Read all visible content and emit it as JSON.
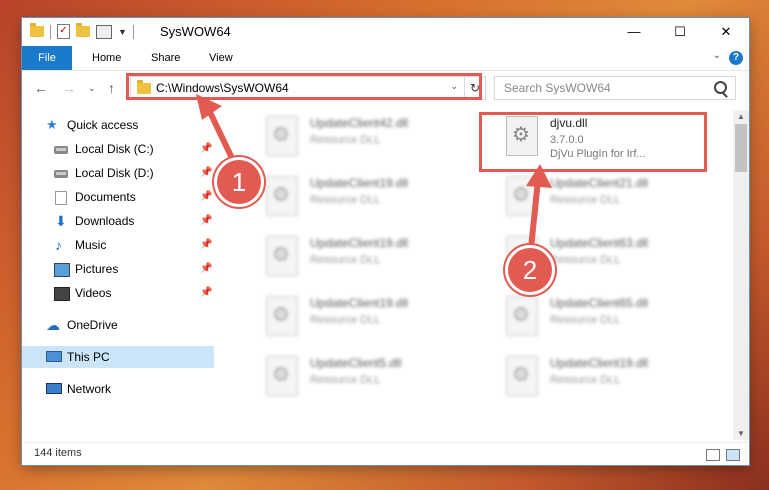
{
  "window": {
    "title": "SysWOW64",
    "minimize_icon": "minimize-icon",
    "maximize_icon": "maximize-icon",
    "close_icon": "close-icon"
  },
  "ribbon": {
    "tabs": [
      "File",
      "Home",
      "Share",
      "View"
    ],
    "help": "?"
  },
  "nav": {
    "address": "C:\\Windows\\SysWOW64",
    "search_placeholder": "Search SysWOW64"
  },
  "sidebar": {
    "items": [
      {
        "label": "Quick access",
        "icon": "star-icon"
      },
      {
        "label": "Local Disk (C:)",
        "icon": "disk-icon",
        "pinned": true
      },
      {
        "label": "Local Disk (D:)",
        "icon": "disk-icon",
        "pinned": true
      },
      {
        "label": "Documents",
        "icon": "documents-icon",
        "pinned": true
      },
      {
        "label": "Downloads",
        "icon": "downloads-icon",
        "pinned": true
      },
      {
        "label": "Music",
        "icon": "music-icon",
        "pinned": true
      },
      {
        "label": "Pictures",
        "icon": "pictures-icon",
        "pinned": true
      },
      {
        "label": "Videos",
        "icon": "videos-icon",
        "pinned": true
      },
      {
        "label": "OneDrive",
        "icon": "cloud-icon"
      },
      {
        "label": "This PC",
        "icon": "pc-icon",
        "selected": true
      },
      {
        "label": "Network",
        "icon": "network-icon"
      }
    ]
  },
  "files": {
    "left": [
      {
        "name": "UpdateClient42.dll",
        "type": "Resource DLL"
      },
      {
        "name": "UpdateClient19.dll",
        "type": "Resource DLL"
      },
      {
        "name": "UpdateClient19.dll",
        "type": "Resource DLL"
      },
      {
        "name": "UpdateClient19.dll",
        "type": "Resource DLL"
      },
      {
        "name": "UpdateClient5.dll",
        "type": "Resource DLL"
      }
    ],
    "right": [
      {
        "name": "djvu.dll",
        "type": "3.7.0.0",
        "desc": "DjVu PlugIn for Irf..."
      },
      {
        "name": "UpdateClient21.dll",
        "type": "Resource DLL"
      },
      {
        "name": "UpdateClient63.dll",
        "type": "Resource DLL"
      },
      {
        "name": "UpdateClient65.dll",
        "type": "Resource DLL"
      },
      {
        "name": "UpdateClient19.dll",
        "type": "Resource DLL"
      }
    ]
  },
  "status": {
    "count": "144 items"
  },
  "callouts": [
    "1",
    "2"
  ],
  "colors": {
    "accent": "#1979ca",
    "highlight": "#e25b52",
    "selected": "#cce4f7"
  }
}
